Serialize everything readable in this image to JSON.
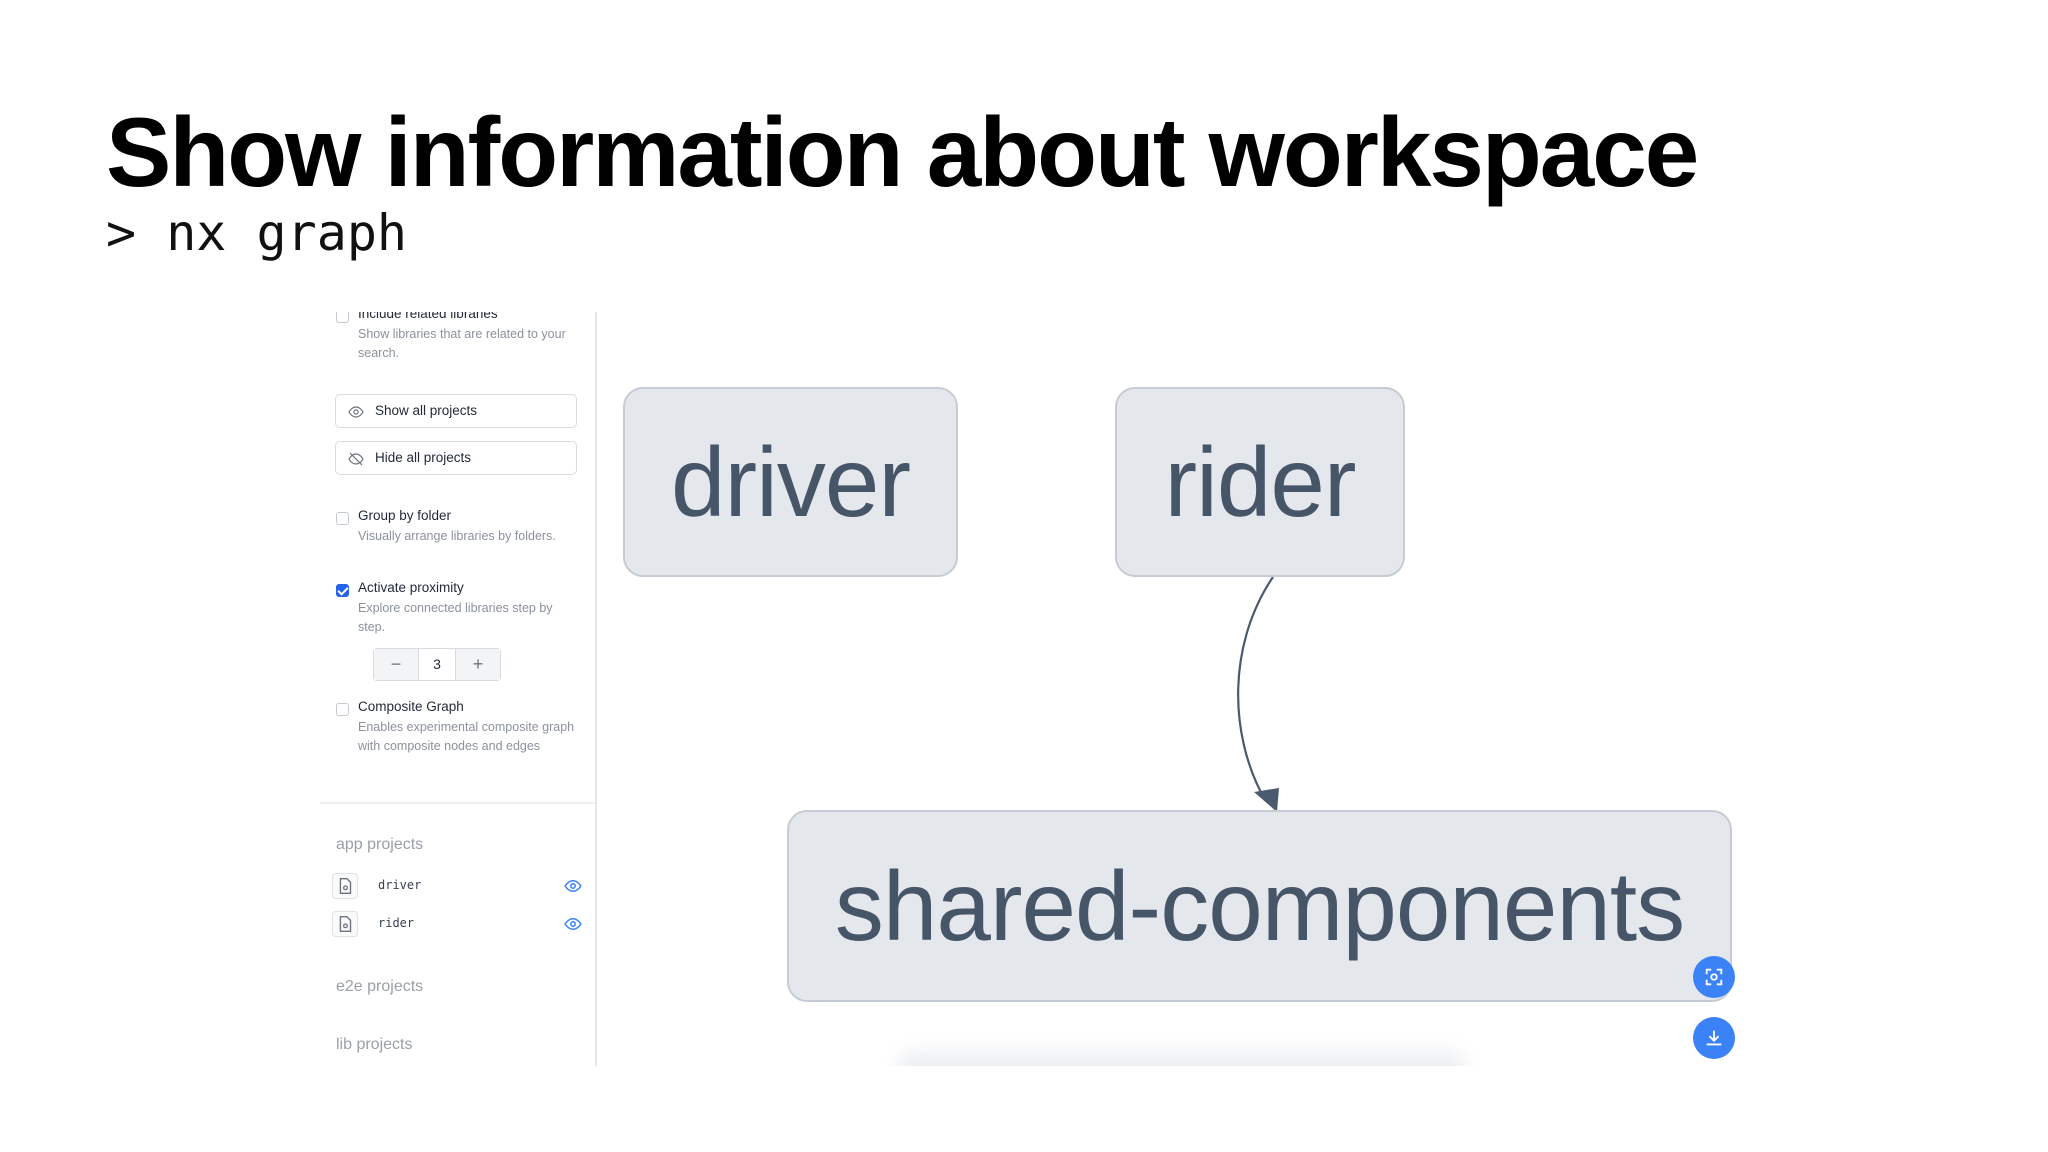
{
  "slide": {
    "title": "Show information about workspace",
    "command": "> nx graph"
  },
  "sidebar": {
    "include_related": {
      "title": "Include related libraries",
      "description": "Show libraries that are related to your search."
    },
    "show_all": "Show all projects",
    "hide_all": "Hide all projects",
    "group_by_folder": {
      "title": "Group by folder",
      "description": "Visually arrange libraries by folders.",
      "checked": false
    },
    "activate_proximity": {
      "title": "Activate proximity",
      "description": "Explore connected libraries step by step.",
      "checked": true
    },
    "proximity_stepper": {
      "minus": "−",
      "value": "3",
      "plus": "+"
    },
    "composite_graph": {
      "title": "Composite Graph",
      "description": "Enables experimental composite graph with composite nodes and edges",
      "checked": false
    },
    "sections": {
      "app": "app projects",
      "e2e": "e2e projects",
      "lib": "lib projects"
    },
    "app_projects": [
      "driver",
      "rider"
    ]
  },
  "graph": {
    "nodes": [
      "driver",
      "rider",
      "shared-components"
    ],
    "edges": [
      {
        "from": "rider",
        "to": "shared-components"
      }
    ]
  },
  "colors": {
    "accent": "#3b82f6",
    "checkbox": "#2563eb",
    "node_bg": "#e4e7ec",
    "node_text": "#475569"
  },
  "icons": {
    "show_all": "eye-icon",
    "hide_all": "eye-off-icon",
    "project": "file-icon",
    "focus": "focus-icon",
    "download": "download-icon"
  }
}
